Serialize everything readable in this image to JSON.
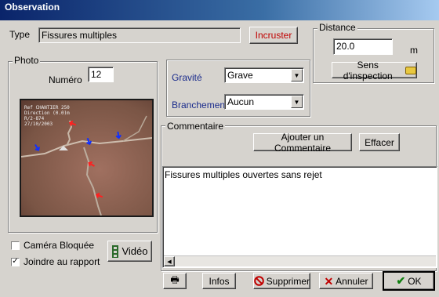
{
  "window": {
    "title": "Observation"
  },
  "type": {
    "label": "Type",
    "value": "Fissures multiples",
    "incruster_label": "Incruster"
  },
  "distance": {
    "group_label": "Distance",
    "value": "20.0",
    "unit": "m",
    "sens_label": "Sens d'inspection"
  },
  "photo": {
    "group_label": "Photo",
    "numero_label": "Numéro",
    "numero_value": "12",
    "overlay_lines": [
      "Ref CHANTIER 250",
      "Direction (0.0)m",
      "R/2-874",
      "27/10/2003"
    ],
    "camera_label": "Caméra Bloquée",
    "camera_checked": false,
    "joindre_label": "Joindre au rapport",
    "joindre_checked": true,
    "joindre_mark": "✓",
    "video_label": "Vidéo"
  },
  "gravite": {
    "label": "Gravité",
    "value": "Grave"
  },
  "branchement": {
    "label": "Branchement",
    "value": "Aucun"
  },
  "commentaire": {
    "group_label": "Commentaire",
    "add_label": "Ajouter un Commentaire",
    "effacer_label": "Effacer",
    "text": "Fissures multiples ouvertes sans rejet"
  },
  "footer": {
    "print_icon": "🖶",
    "infos_label": "Infos",
    "supprimer_label": "Supprimer",
    "annuler_label": "Annuler",
    "ok_label": "OK"
  },
  "colors": {
    "accent_red": "#c00000",
    "label_blue": "#1a2b8c",
    "titlebar": "#0a246a"
  }
}
